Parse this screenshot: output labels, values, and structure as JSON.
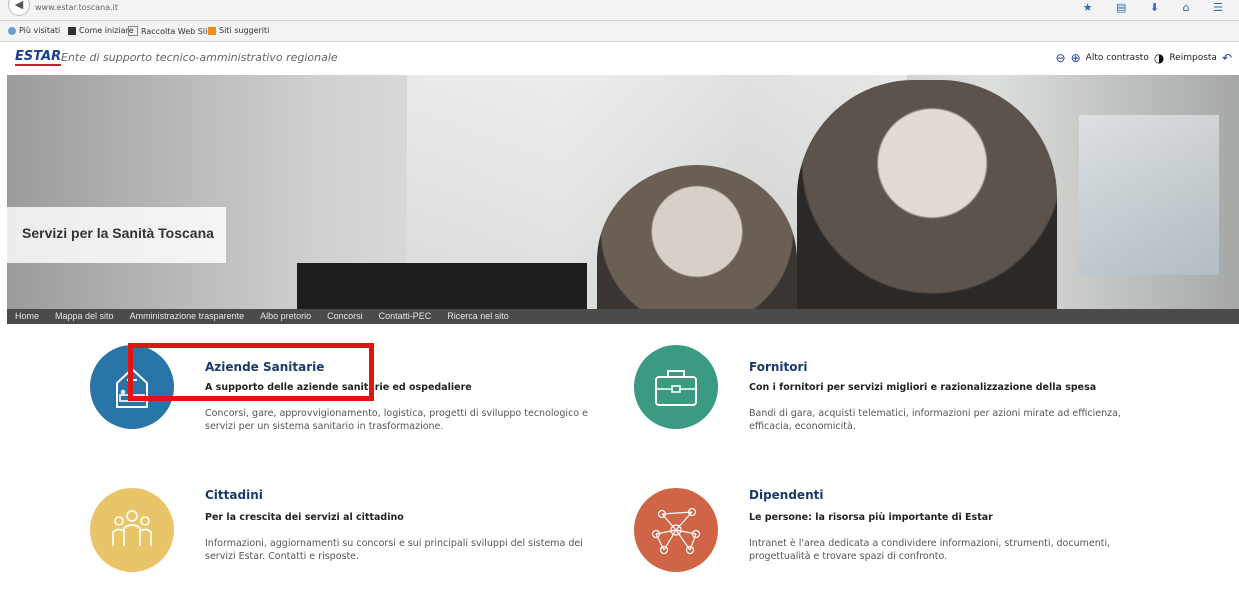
{
  "browser": {
    "url": "www.estar.toscana.it",
    "bookmarks": [
      "Più visitati",
      "Come iniziare",
      "Raccolta Web Slice",
      "Siti suggeriti"
    ]
  },
  "header": {
    "logo": "ESTAR",
    "tagline": "Ente di supporto tecnico-amministrativo regionale",
    "high_contrast": "Alto contrasto",
    "reset": "Reimposta"
  },
  "hero": {
    "caption": "Servizi per la Sanità Toscana"
  },
  "nav": [
    "Home",
    "Mappa del sito",
    "Amministrazione trasparente",
    "Albo pretorio",
    "Concorsi",
    "Contatti-PEC",
    "Ricerca nel sito"
  ],
  "services": [
    {
      "title": "Aziende Sanitarie",
      "subtitle": "A supporto delle aziende sanitarie ed ospedaliere",
      "description": "Concorsi, gare, approvvigionamento, logistica, progetti di sviluppo tecnologico e servizi per un sistema sanitario in trasformazione.",
      "color": "#2a75a8",
      "icon": "hospital-bed-icon"
    },
    {
      "title": "Fornitori",
      "subtitle": "Con i fornitori per servizi migliori e razionalizzazione della spesa",
      "description": "Bandi di gara, acquisti telematici, informazioni per azioni mirate ad efficienza, efficacia, economicità.",
      "color": "#3a9a82",
      "icon": "briefcase-icon"
    },
    {
      "title": "Cittadini",
      "subtitle": "Per la crescita dei servizi al cittadino",
      "description": "Informazioni, aggiornamenti su concorsi e sui principali sviluppi del sistema dei servizi Estar. Contatti e risposte.",
      "color": "#e9c56a",
      "icon": "people-icon"
    },
    {
      "title": "Dipendenti",
      "subtitle": "Le persone: la risorsa più importante di Estar",
      "description": "Intranet è l'area dedicata a condividere informazioni, strumenti, documenti, progettualità e trovare spazi di confronto.",
      "color": "#cf6447",
      "icon": "network-icon"
    }
  ],
  "colors": {
    "brand": "#1b3f8f",
    "title": "#1b3a6b",
    "highlight": "#e11313",
    "nav_bg": "#4b4b4b"
  }
}
